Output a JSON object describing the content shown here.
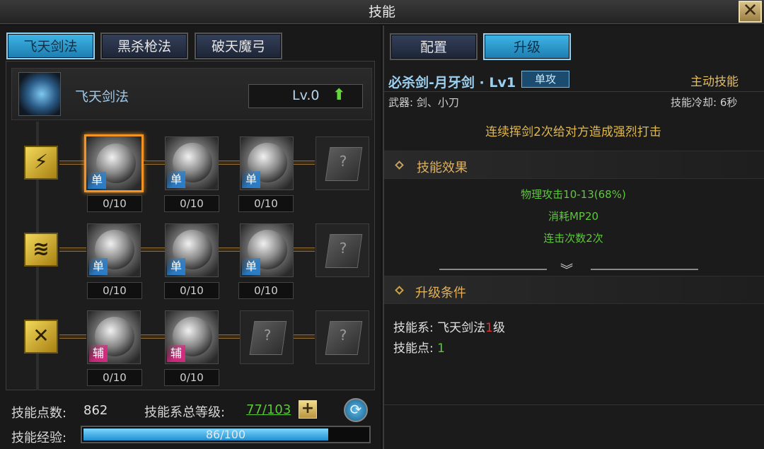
{
  "window": {
    "title": "技能",
    "close_icon": "close-x-icon"
  },
  "tree_tabs": [
    {
      "label": "飞天剑法",
      "active": true
    },
    {
      "label": "黑杀枪法",
      "active": false
    },
    {
      "label": "破天魔弓",
      "active": false
    }
  ],
  "tree_header": {
    "name": "飞天剑法",
    "level": "Lv.0",
    "icon": "sword-icon",
    "upgrade_icon": "green-up-arrow-icon"
  },
  "rows": [
    {
      "category_icon": "claw-slash-icon",
      "skills": [
        {
          "tag": "单",
          "tag_type": "single",
          "count": "0/10",
          "selected": true
        },
        {
          "tag": "单",
          "tag_type": "single",
          "count": "0/10"
        },
        {
          "tag": "单",
          "tag_type": "single",
          "count": "0/10"
        }
      ]
    },
    {
      "category_icon": "triple-slash-icon",
      "skills": [
        {
          "tag": "单",
          "tag_type": "single",
          "count": "0/10"
        },
        {
          "tag": "单",
          "tag_type": "single",
          "count": "0/10"
        },
        {
          "tag": "单",
          "tag_type": "single",
          "count": "0/10"
        }
      ]
    },
    {
      "category_icon": "cross-strike-icon",
      "skills": [
        {
          "tag": "辅",
          "tag_type": "support",
          "count": "0/10"
        },
        {
          "tag": "辅",
          "tag_type": "support",
          "count": "0/10"
        }
      ]
    }
  ],
  "stats": {
    "points_label": "技能点数:",
    "points_value": "862",
    "total_label": "技能系总等级:",
    "total_value": "77/103",
    "exp_label": "技能经验:",
    "exp_text": "86/100",
    "exp_fraction": 0.86,
    "plus_icon": "plus-icon",
    "refresh_icon": "refresh-icon"
  },
  "right_tabs": [
    {
      "label": "配置",
      "active": false
    },
    {
      "label": "升级",
      "active": true
    }
  ],
  "skill": {
    "name": "必杀剑-月牙剑 · Lv1",
    "type_badge": "单攻",
    "kind": "主动技能",
    "weapon": "武器: 剑、小刀",
    "cooldown": "技能冷却: 6秒",
    "description": "连续挥剑2次给对方造成强烈打击"
  },
  "effects": {
    "title": "技能效果",
    "lines": [
      "物理攻击10-13(68%)",
      "消耗MP20",
      "连击次数2次"
    ],
    "expand_icon": "chevron-down-icon"
  },
  "requirements": {
    "title": "升级条件",
    "tree_label": "技能系: ",
    "tree_name": "飞天剑法",
    "tree_level": "1",
    "tree_suffix": "级",
    "points_label": "技能点: ",
    "points_value": "1"
  },
  "colors": {
    "accent_blue": "#3fb6e6",
    "gold": "#e0b850",
    "green": "#5cc83a",
    "selection": "#f09428"
  }
}
